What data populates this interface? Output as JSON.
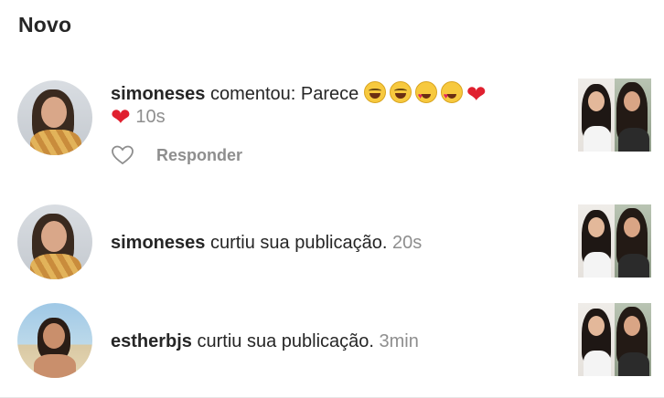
{
  "section_title": "Novo",
  "notifications": [
    {
      "username": "simoneses",
      "action_text": "comentou: Parece",
      "comment_emojis": [
        "joy-emoji",
        "joy-emoji",
        "heart-eyes-emoji",
        "heart-eyes-emoji",
        "red-heart-emoji",
        "red-heart-emoji"
      ],
      "time": "10s",
      "reply_label": "Responder"
    },
    {
      "username": "simoneses",
      "action_text": "curtiu sua publicação.",
      "time": "20s"
    },
    {
      "username": "estherbjs",
      "action_text": "curtiu sua publicação.",
      "time": "3min"
    }
  ],
  "colors": {
    "text": "#262626",
    "secondary": "#8e8e8e",
    "heart": "#e0202f"
  }
}
